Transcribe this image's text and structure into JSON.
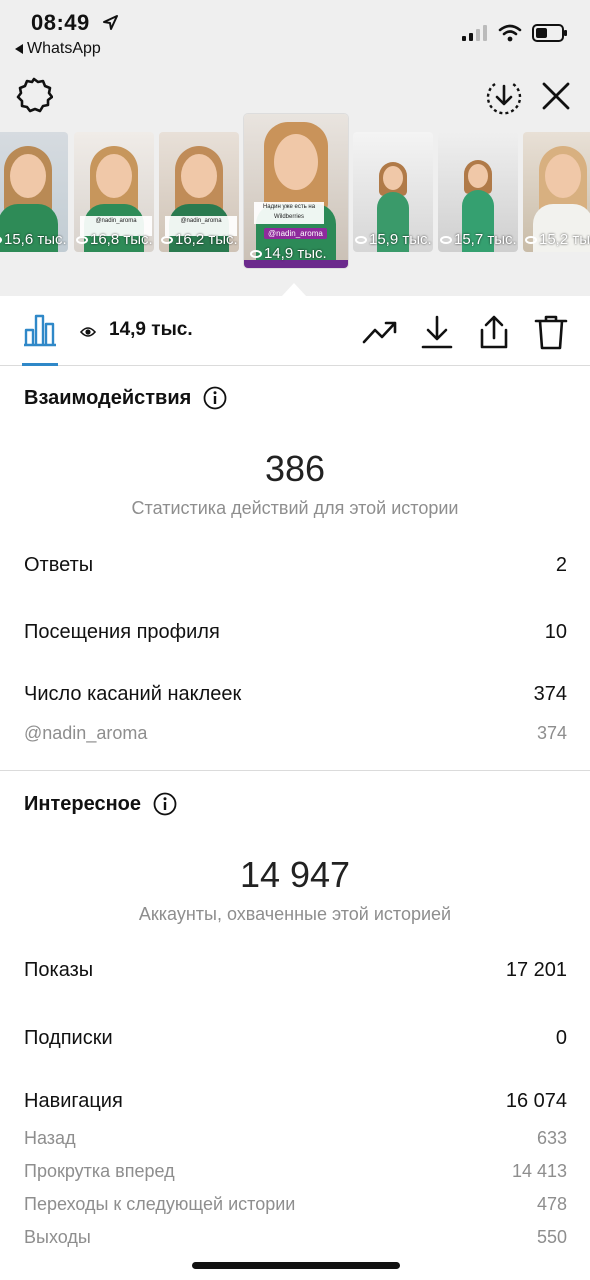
{
  "status_bar": {
    "time": "08:49",
    "back_app": "WhatsApp"
  },
  "stories": [
    {
      "views": "15,6 тыс.",
      "caption": ""
    },
    {
      "views": "16,8 тыс.",
      "caption": "@nadin_aroma"
    },
    {
      "views": "16,2 тыс.",
      "caption": "@nadin_aroma"
    },
    {
      "views": "14,9 тыс.",
      "caption": "Надин уже есть на Wildberries",
      "tag": "@nadin_aroma",
      "active": true
    },
    {
      "views": "15,9 тыс.",
      "caption": ""
    },
    {
      "views": "15,7 тыс.",
      "caption": ""
    },
    {
      "views": "15,2 тыс.",
      "caption": ""
    }
  ],
  "action_bar": {
    "view_count": "14,9 тыс."
  },
  "interactions": {
    "title": "Взаимодействия",
    "total": "386",
    "subtitle": "Статистика действий для этой истории",
    "rows": [
      {
        "label": "Ответы",
        "value": "2"
      },
      {
        "label": "Посещения профиля",
        "value": "10"
      },
      {
        "label": "Число касаний наклеек",
        "value": "374"
      }
    ],
    "sub_rows": [
      {
        "label": "@nadin_aroma",
        "value": "374"
      }
    ]
  },
  "discovery": {
    "title": "Интересное",
    "total": "14 947",
    "subtitle": "Аккаунты, охваченные этой историей",
    "rows": [
      {
        "label": "Показы",
        "value": "17 201"
      },
      {
        "label": "Подписки",
        "value": "0"
      },
      {
        "label": "Навигация",
        "value": "16 074"
      }
    ],
    "sub_rows": [
      {
        "label": "Назад",
        "value": "633"
      },
      {
        "label": "Прокрутка вперед",
        "value": "14 413"
      },
      {
        "label": "Переходы к следующей истории",
        "value": "478"
      },
      {
        "label": "Выходы",
        "value": "550"
      }
    ]
  },
  "colors": {
    "accent": "#2f88c8",
    "muted_text": "#8e8e8e",
    "top_background": "#efefef"
  }
}
